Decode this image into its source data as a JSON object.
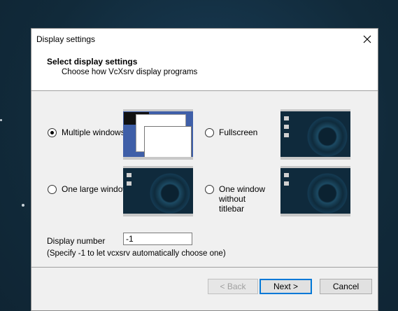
{
  "window": {
    "title": "Display settings",
    "close_icon": "close-icon"
  },
  "header": {
    "title": "Select display settings",
    "subtitle": "Choose how VcXsrv display programs"
  },
  "options": [
    {
      "label": "Multiple windows",
      "selected": true
    },
    {
      "label": "Fullscreen",
      "selected": false
    },
    {
      "label": "One large window",
      "selected": false
    },
    {
      "label": "One window without titlebar",
      "selected": false
    }
  ],
  "display_number": {
    "label": "Display number",
    "value": "-1",
    "hint": "(Specify -1 to let vcxsrv automatically choose one)"
  },
  "buttons": {
    "back": "< Back",
    "next": "Next >",
    "cancel": "Cancel"
  },
  "colors": {
    "accent": "#0078d7",
    "desktop": "#0f2a3c"
  }
}
